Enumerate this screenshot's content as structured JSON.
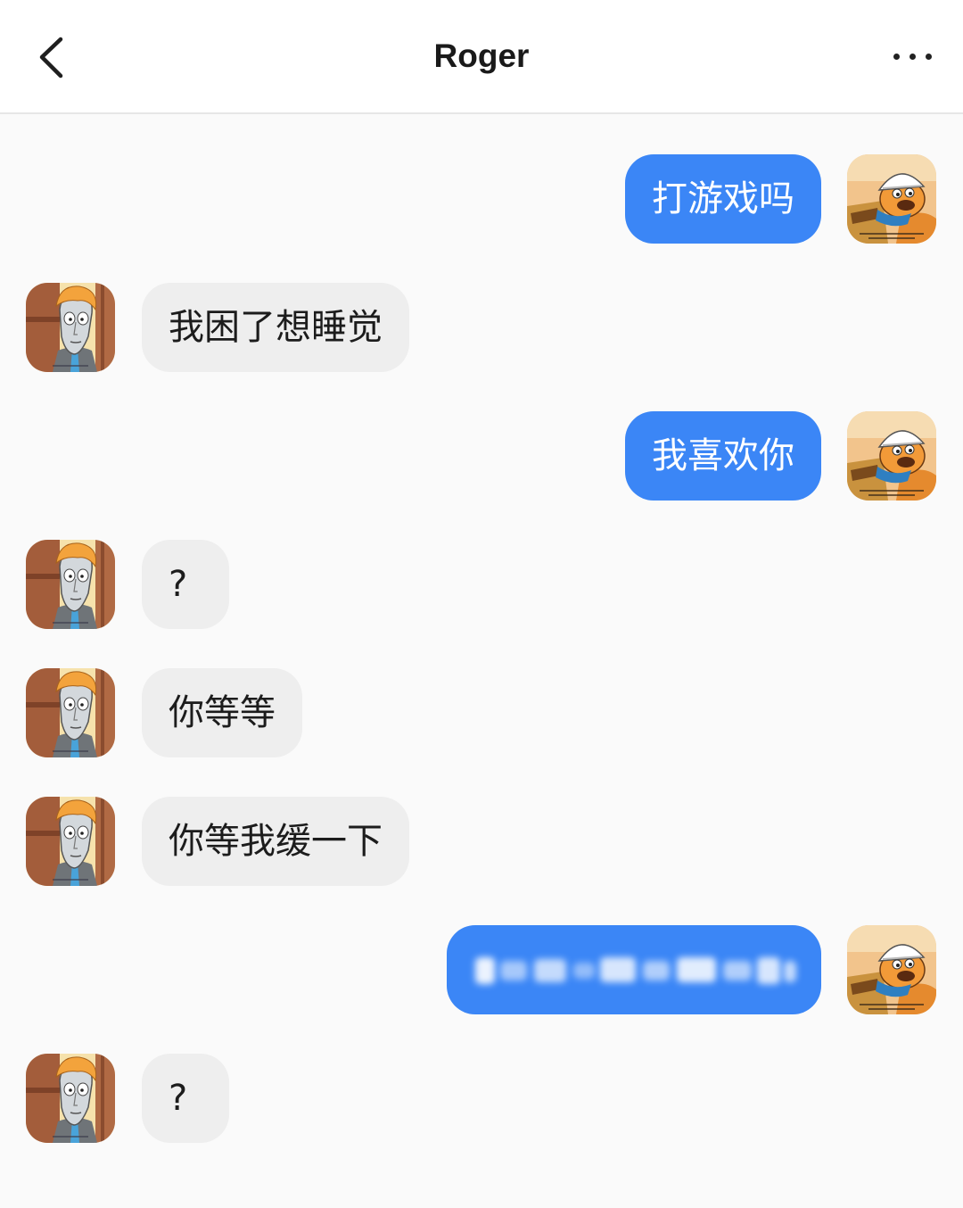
{
  "header": {
    "title": "Roger",
    "back_icon": "chevron-left-icon",
    "more_icon": "more-horizontal-icon"
  },
  "colors": {
    "background": "#fafafa",
    "outgoing_bubble": "#3b86f6",
    "outgoing_text": "#ffffff",
    "incoming_bubble": "#eeeeee",
    "incoming_text": "#1c1c1c"
  },
  "avatars": {
    "me": "hardhat-cartoon-character-avatar-icon",
    "contact": "orange-hair-cartoon-character-avatar-icon"
  },
  "messages": [
    {
      "from_me": true,
      "text": "打游戏吗"
    },
    {
      "from_me": false,
      "text": "我困了想睡觉"
    },
    {
      "from_me": true,
      "text": "我喜欢你"
    },
    {
      "from_me": false,
      "text": "?"
    },
    {
      "from_me": false,
      "text": "你等等"
    },
    {
      "from_me": false,
      "text": "你等我缓一下"
    },
    {
      "from_me": true,
      "blurred": true
    },
    {
      "from_me": false,
      "text": "?"
    }
  ]
}
